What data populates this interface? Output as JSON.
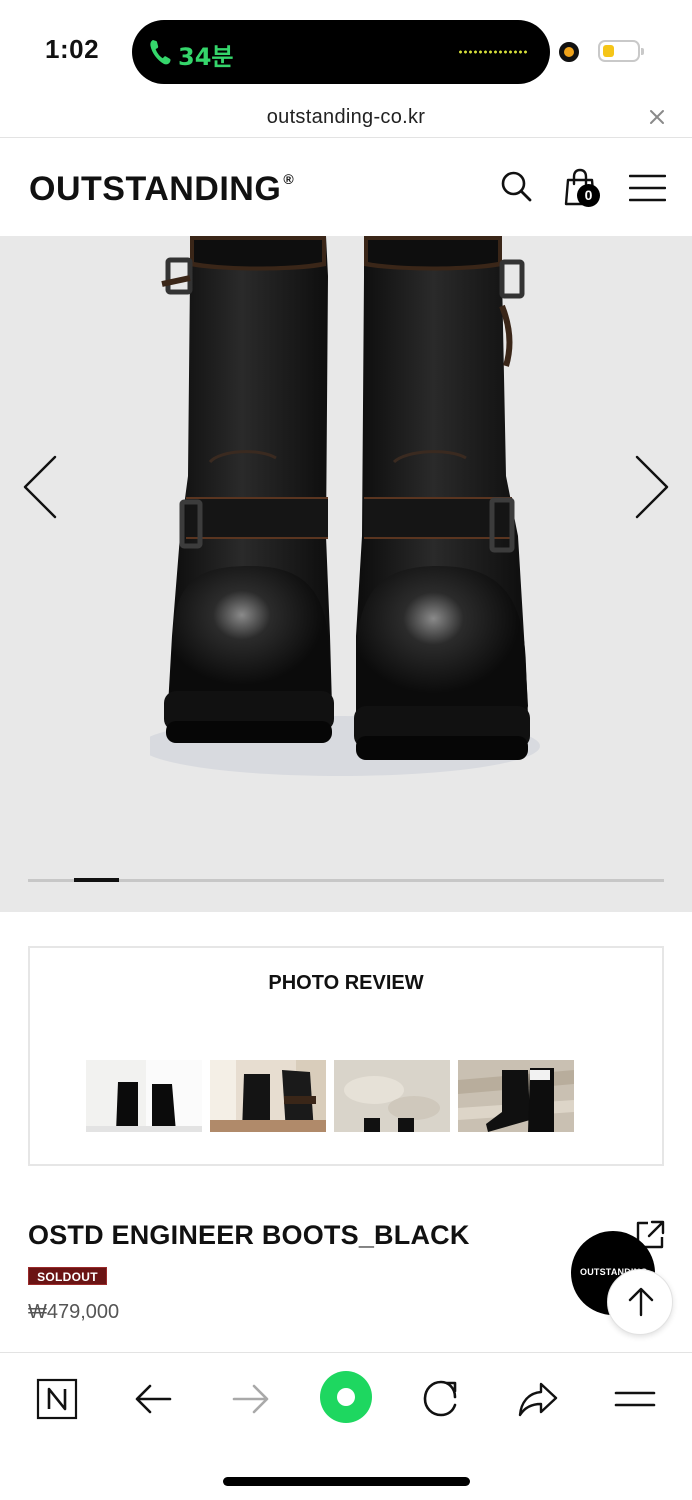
{
  "status_bar": {
    "time": "1:02",
    "call_duration": "34분",
    "icons": [
      "phone-icon",
      "camera-indicator-icon",
      "battery-icon"
    ]
  },
  "browser": {
    "url": "outstanding-co.kr",
    "close_icon": "close-icon"
  },
  "header": {
    "logo": "OUTSTANDING",
    "logo_mark": "®",
    "cart_count": "0",
    "icons": [
      "search-icon",
      "cart-icon",
      "menu-icon"
    ]
  },
  "gallery": {
    "image": "black engineer boots product photo",
    "slide_progress": 0.07,
    "icons": [
      "chevron-left-icon",
      "chevron-right-icon"
    ]
  },
  "photo_review": {
    "title": "PHOTO REVIEW",
    "thumbnail_count": 4
  },
  "product": {
    "name": "OSTD ENGINEER BOOTS_BLACK",
    "badge": "SOLDOUT",
    "price": "₩479,000",
    "brand_bubble": "OUTSTANDING"
  },
  "toolbar": {
    "icons": [
      "naver-n-icon",
      "back-arrow-icon",
      "forward-arrow-icon",
      "green-dot-icon",
      "reload-icon",
      "share-icon",
      "menu-lines-icon"
    ]
  },
  "colors": {
    "call_green": "#35d66b",
    "soldout_bg": "#6b1414",
    "gallery_bg": "#e8e8e8",
    "toolbar_green": "#1ed760"
  }
}
